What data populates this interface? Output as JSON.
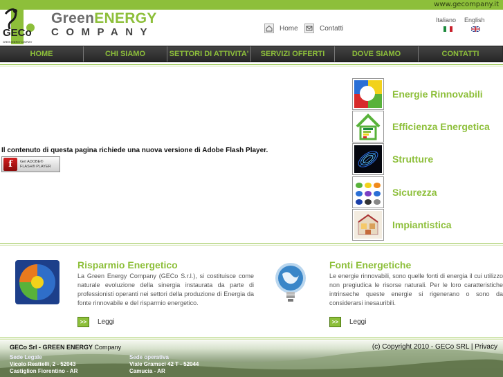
{
  "top_bar": {
    "url": "www.gecompany.it"
  },
  "brand": {
    "logo_letters": "GECo",
    "logo_tagline": "GREEN ENERGY COMPANY",
    "name_part1": "Green",
    "name_part2": "ENERGY",
    "name_line2": "COMPANY"
  },
  "top_links": {
    "home": "Home",
    "contacts": "Contatti"
  },
  "languages": {
    "italian": "Italiano",
    "english": "English"
  },
  "nav": [
    {
      "label": "HOME"
    },
    {
      "label": "CHI SIAMO"
    },
    {
      "label": "SETTORI DI ATTIVITA'"
    },
    {
      "label": "SERVIZI OFFERTI"
    },
    {
      "label": "DOVE SIAMO"
    },
    {
      "label": "CONTATTI"
    }
  ],
  "flash": {
    "message": "Il contenuto di questa pagina richiede una nuova versione di Adobe Flash Player.",
    "badge_line1": "Get ADOBE®",
    "badge_line2": "FLASH® PLAYER"
  },
  "categories": [
    {
      "label": "Energie Rinnovabili"
    },
    {
      "label": "Efficienza Energetica"
    },
    {
      "label": "Strutture"
    },
    {
      "label": "Sicurezza"
    },
    {
      "label": "Impiantistica"
    }
  ],
  "features": [
    {
      "title": "Risparmio Energetico",
      "text": "La Green Energy Company (GECo S.r.l.), si costituisce come naturale evoluzione della sinergia instaurata da parte di professionisti operanti nei settori della produzione di Energia da fonte rinnovabile e del risparmio energetico.",
      "more": "Leggi",
      "arrow": ">>"
    },
    {
      "title": "Fonti Energetiche",
      "text": "Le energie rinnovabili, sono quelle fonti di energia il cui utilizzo non pregiudica le risorse naturali. Per le loro caratteristiche intrinseche queste energie si rigenerano o sono da considerarsi inesauribili.",
      "more": "Leggi",
      "arrow": ">>"
    }
  ],
  "footer": {
    "company_bold": "GECo Srl - GREEN ENERGY",
    "company_rest": "Company",
    "copyright": "(c) Copyright 2010 - GECo SRL | Privacy",
    "legal_heading": "Sede Legale",
    "legal_line1": "Vicolo Reattelli, 2  - 52043",
    "legal_line2": "Castiglion Fiorentino - AR",
    "op_heading": "Sede operativa",
    "op_line1": "Viale Gramsci 42 T - 52044",
    "op_line2": "Camucia - AR"
  },
  "colors": {
    "accent": "#8dbf3a",
    "nav_bg": "#2b2b2b"
  }
}
